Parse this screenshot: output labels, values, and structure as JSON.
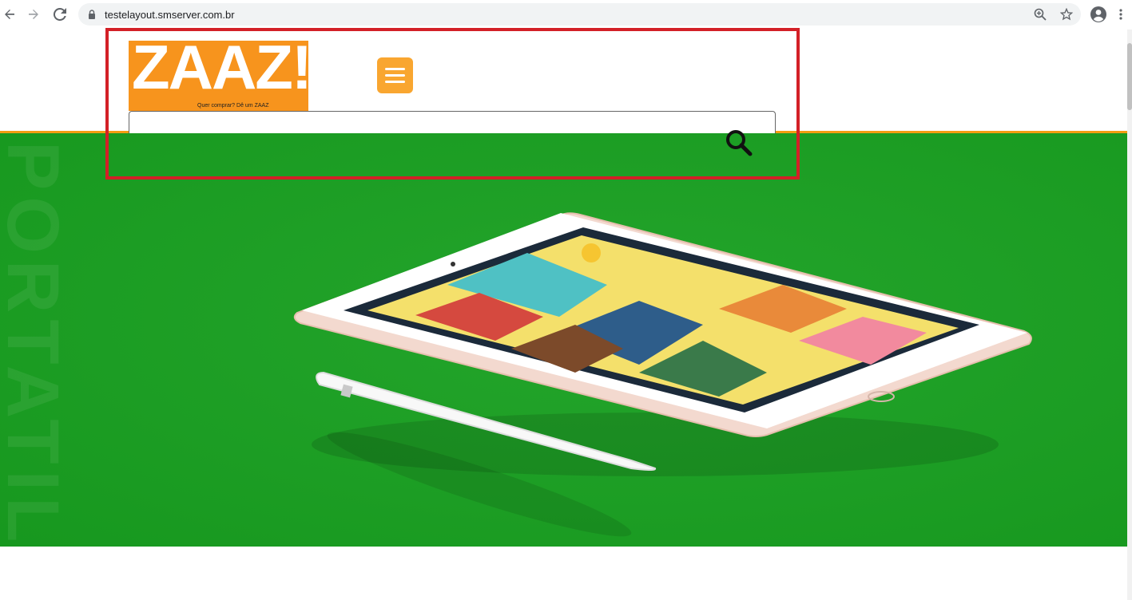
{
  "browser": {
    "url": "testelayout.smserver.com.br",
    "icons": [
      "back-arrow-icon",
      "forward-arrow-icon",
      "reload-icon",
      "lock-icon",
      "zoom-icon",
      "star-icon",
      "profile-icon",
      "menu-dots-icon"
    ]
  },
  "header": {
    "logo": {
      "text": "ZAAZ!",
      "tagline": "Quer comprar? Dê um ZAAZ"
    },
    "search": {
      "value": ""
    }
  },
  "hero": {
    "background_word": "PORTATIL"
  },
  "colors": {
    "brand_orange": "#f7941d",
    "hamburger": "#f9a630",
    "accent_line": "#f39c12",
    "hero_green": "#18a020",
    "annotation": "#d32027"
  }
}
